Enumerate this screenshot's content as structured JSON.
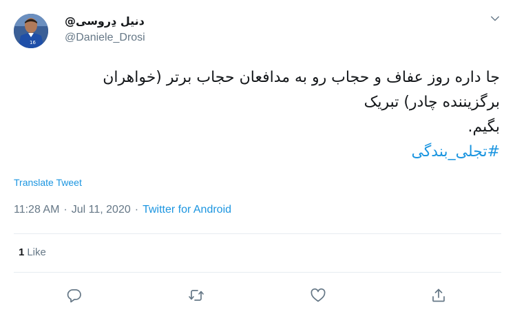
{
  "author": {
    "display_name": "@دنیل دِروسی",
    "handle": "@Daniele_Drosi",
    "avatar_jersey_number": "16"
  },
  "tweet": {
    "lines": [
      "جا داره روز عفاف و حجاب رو به مدافعان حجاب برتر (خواهران",
      "برگزیننده چادر) تبریک",
      "بگیم."
    ],
    "hashtag": "#تجلی_بندگی"
  },
  "translate_label": "Translate Tweet",
  "meta": {
    "time": "11:28 AM",
    "separator1": "·",
    "date": "Jul 11, 2020",
    "separator2": "·",
    "source": "Twitter for Android"
  },
  "stats": {
    "likes_count": "1",
    "likes_label": "Like"
  },
  "icons": {
    "caret": "chevron-down-icon",
    "reply": "reply-icon",
    "retweet": "retweet-icon",
    "like": "heart-icon",
    "share": "share-icon"
  },
  "colors": {
    "link": "#1b95e0",
    "muted": "#657786",
    "text": "#14171a",
    "divider": "#e6ecf0"
  }
}
